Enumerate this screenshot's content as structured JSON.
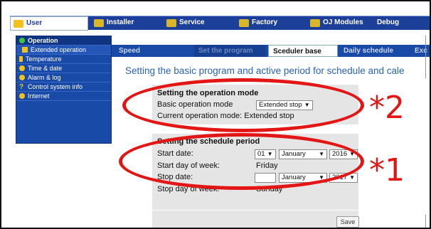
{
  "top_tabs": [
    {
      "label": "User"
    },
    {
      "label": "Installer"
    },
    {
      "label": "Service"
    },
    {
      "label": "Factory"
    },
    {
      "label": "OJ Modules"
    },
    {
      "label": "Debug"
    }
  ],
  "sidebar": {
    "items": [
      {
        "label": "Operation"
      },
      {
        "label": "Extended operation"
      },
      {
        "label": "Temperature"
      },
      {
        "label": "Time & date"
      },
      {
        "label": "Alarm & log"
      },
      {
        "label": "Control system info"
      },
      {
        "label": "Internet"
      }
    ]
  },
  "sub_tabs": [
    {
      "label": "Speed"
    },
    {
      "label": "Set the program"
    },
    {
      "label": "Sceduler base"
    },
    {
      "label": "Daily schedule"
    },
    {
      "label": "Exc"
    }
  ],
  "page": {
    "heading": "Setting the basic program and active period for schedule and cale"
  },
  "operation_mode": {
    "title": "Setting the operation mode",
    "basic_label": "Basic operation mode",
    "basic_value": "Extended stop",
    "current_text": "Current operation mode: Extended stop"
  },
  "schedule_period": {
    "title": "Setting the schedule period",
    "start_date_label": "Start date:",
    "start_day": "01",
    "start_month": "January",
    "start_year": "2016",
    "start_dow_label": "Start day of week:",
    "start_dow_value": "Friday",
    "stop_date_label": "Stop date:",
    "stop_month": "January",
    "stop_year": "2017",
    "stop_dow_label": "Stop day of week:",
    "stop_dow_value": "Sunday"
  },
  "save_label": "Save",
  "annotations": {
    "a2": "*2",
    "a1": "*1",
    "color": "#e31616"
  }
}
